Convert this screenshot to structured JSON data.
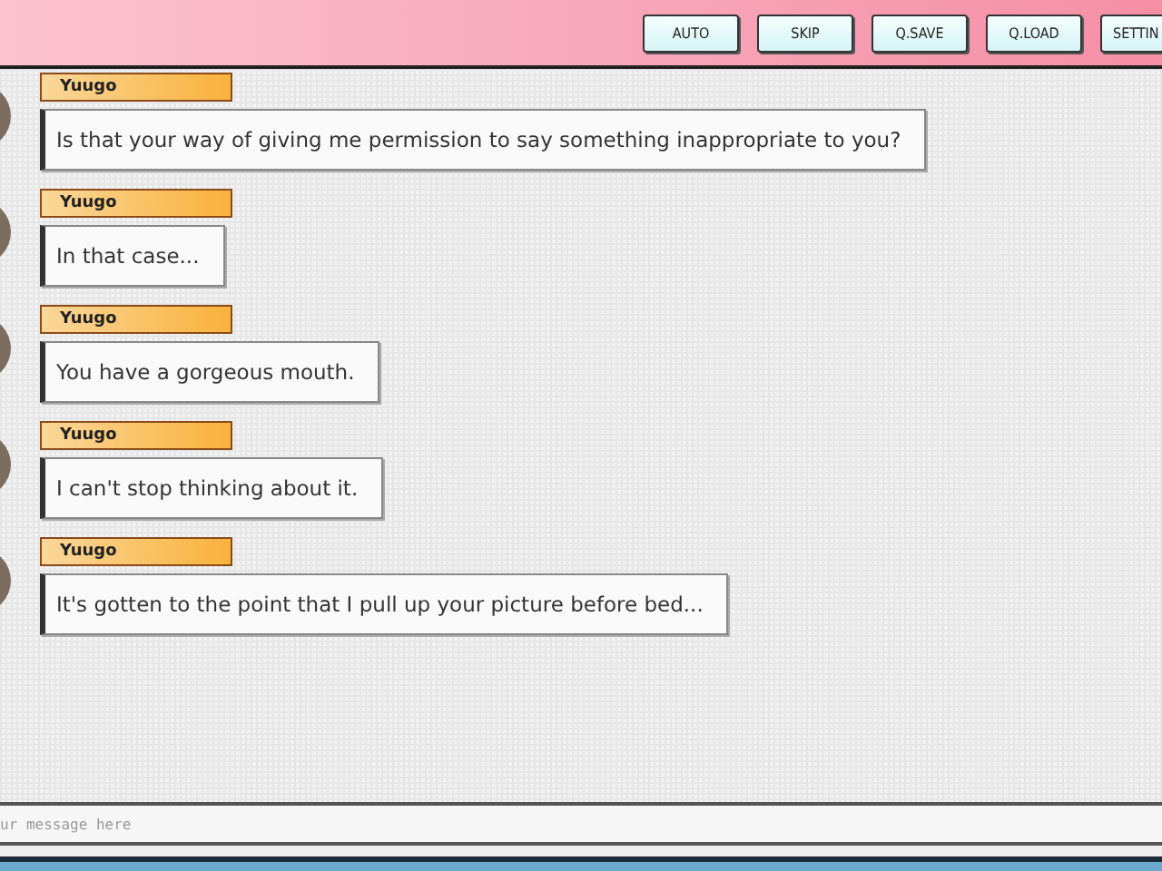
{
  "toolbar": {
    "buttons": [
      "AUTO",
      "SKIP",
      "Q.SAVE",
      "Q.LOAD",
      "SETTIN"
    ]
  },
  "messages": [
    {
      "speaker": "Yuugo",
      "text": "Is that your way of giving me permission to say something inappropriate to you?"
    },
    {
      "speaker": "Yuugo",
      "text": "In that case..."
    },
    {
      "speaker": "Yuugo",
      "text": "You have a gorgeous mouth."
    },
    {
      "speaker": "Yuugo",
      "text": "I can't stop thinking about it."
    },
    {
      "speaker": "Yuugo",
      "text": "It's gotten to the point that I pull up your picture before bed..."
    }
  ],
  "input": {
    "placeholder": "ur message here"
  }
}
